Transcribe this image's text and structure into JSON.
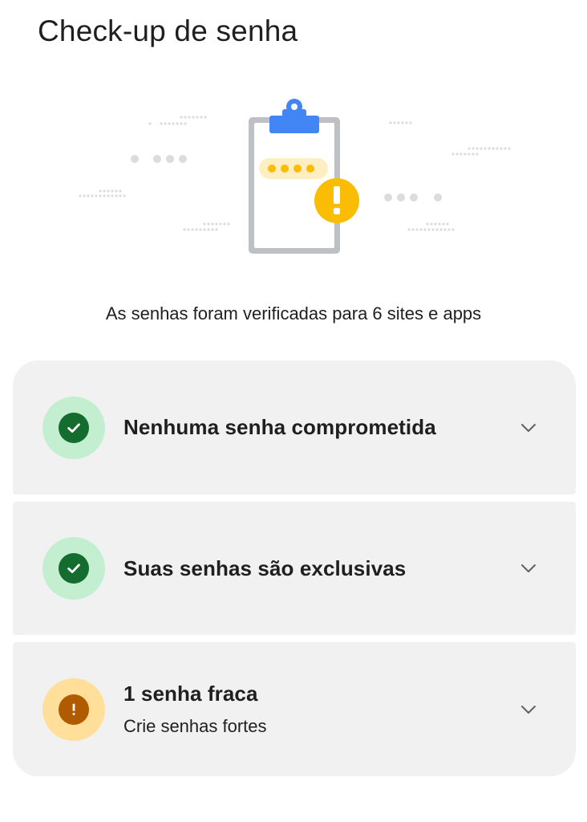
{
  "page": {
    "title": "Check-up de senha",
    "summary": "As senhas foram verificadas para 6 sites e apps"
  },
  "colors": {
    "ok_bg": "#c4eed0",
    "ok_fg": "#146c2e",
    "warn_bg": "#ffdf99",
    "warn_fg": "#b05b00",
    "card_bg": "#f1f1f1",
    "clipboard_blue": "#4285f4",
    "alert_yellow": "#fbbc04"
  },
  "checks": [
    {
      "status": "ok",
      "icon": "check-icon",
      "title": "Nenhuma senha comprometida"
    },
    {
      "status": "ok",
      "icon": "check-icon",
      "title": "Suas senhas são exclusivas"
    },
    {
      "status": "warn",
      "icon": "exclamation-icon",
      "title": "1 senha fraca",
      "subtitle": "Crie senhas fortes"
    }
  ]
}
